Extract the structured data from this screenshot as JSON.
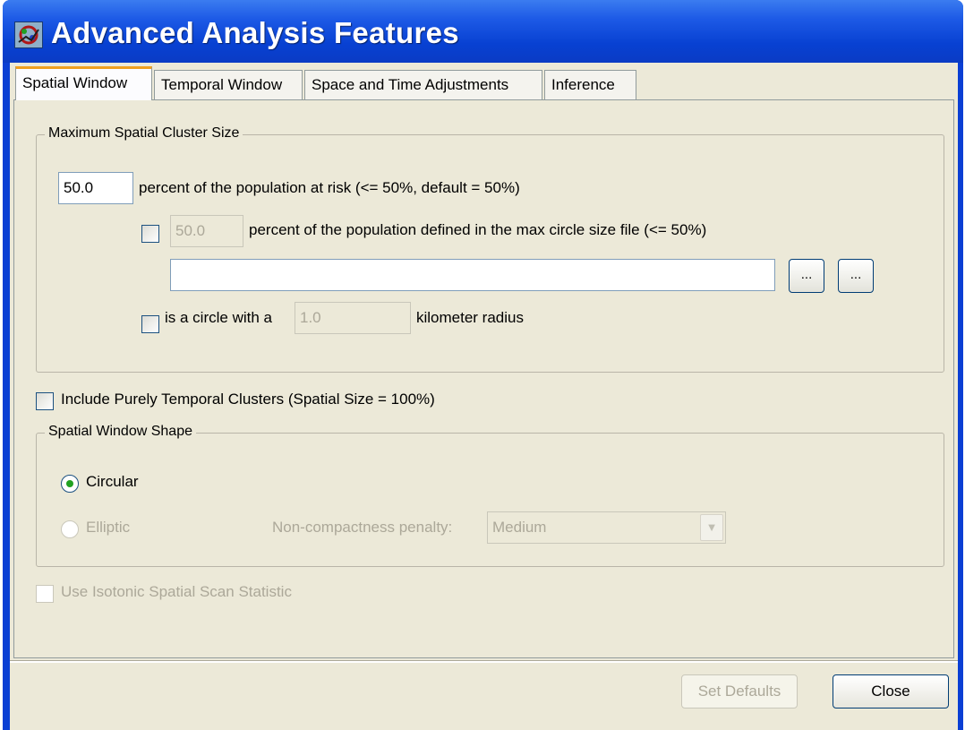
{
  "window": {
    "title": "Advanced Analysis Features"
  },
  "tabs": [
    {
      "label": "Spatial Window"
    },
    {
      "label": "Temporal Window"
    },
    {
      "label": "Space and Time Adjustments"
    },
    {
      "label": "Inference"
    }
  ],
  "max_cluster": {
    "legend": "Maximum Spatial Cluster Size",
    "percent_value": "50.0",
    "percent_label": "percent of the population at risk (<= 50%, default = 50%)",
    "file_percent_value": "50.0",
    "file_percent_label": "percent of the population defined in the max circle size file (<= 50%)",
    "file_path": "",
    "browse_label": "...",
    "import_label": "...",
    "circle_label": "is a circle with a",
    "radius_value": "1.0",
    "radius_label": "kilometer radius"
  },
  "include_temporal_label": "Include Purely Temporal Clusters (Spatial Size = 100%)",
  "window_shape": {
    "legend": "Spatial Window Shape",
    "circular_label": "Circular",
    "elliptic_label": "Elliptic",
    "penalty_label": "Non-compactness penalty:",
    "penalty_value": "Medium"
  },
  "isotonic_label": "Use Isotonic Spatial Scan Statistic",
  "footer": {
    "set_defaults_label": "Set Defaults",
    "close_label": "Close"
  }
}
